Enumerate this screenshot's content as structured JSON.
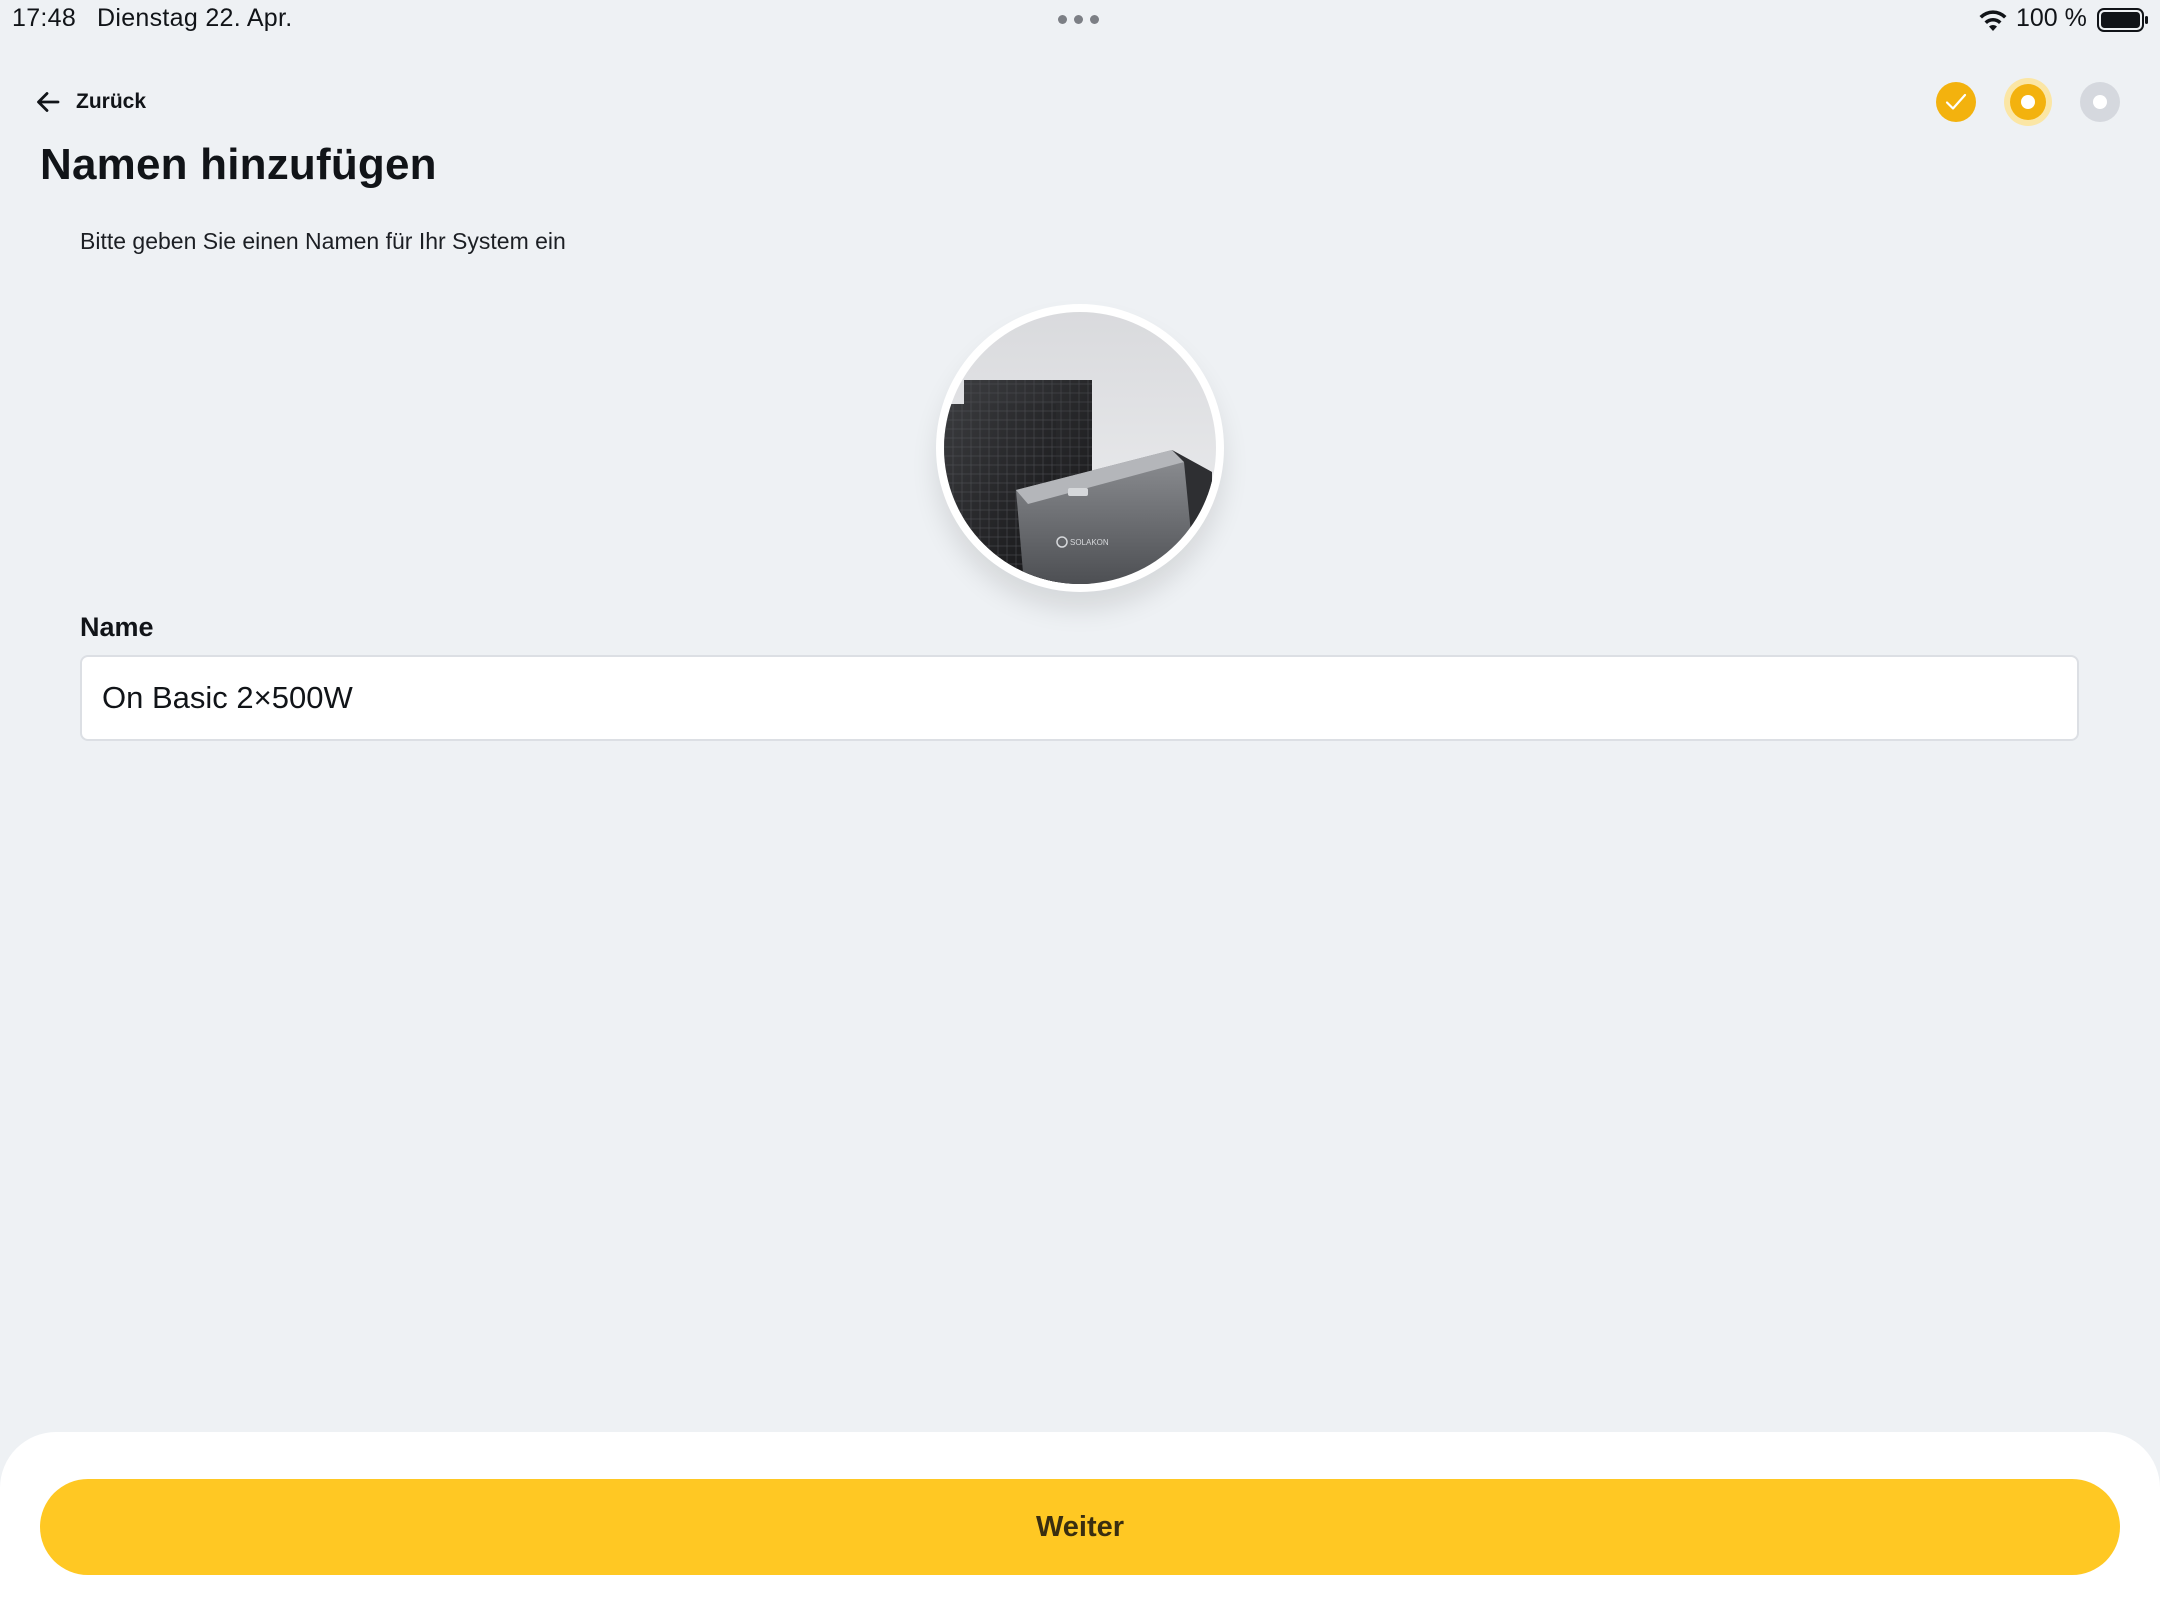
{
  "status_bar": {
    "time": "17:48",
    "date": "Dienstag 22. Apr.",
    "battery_percent": "100 %",
    "battery_level": 1.0,
    "icons": [
      "wifi-icon",
      "battery-icon",
      "multitask-dots-icon"
    ]
  },
  "header": {
    "back_label": "Zurück",
    "back_icon": "arrow-left-icon",
    "steps": [
      {
        "state": "completed",
        "icon": "checkmark-icon"
      },
      {
        "state": "current"
      },
      {
        "state": "upcoming"
      }
    ]
  },
  "main": {
    "title": "Namen hinzufügen",
    "subtitle": "Bitte geben Sie einen Namen für Ihr System ein",
    "product_image_brand": "SOLAKON",
    "field_label": "Name",
    "name_value": "On Basic 2×500W"
  },
  "footer": {
    "continue_label": "Weiter"
  },
  "colors": {
    "background": "#EEF1F4",
    "accent": "#F3B20E",
    "button": "#FFC823",
    "step_upcoming": "#D5D8DE"
  }
}
